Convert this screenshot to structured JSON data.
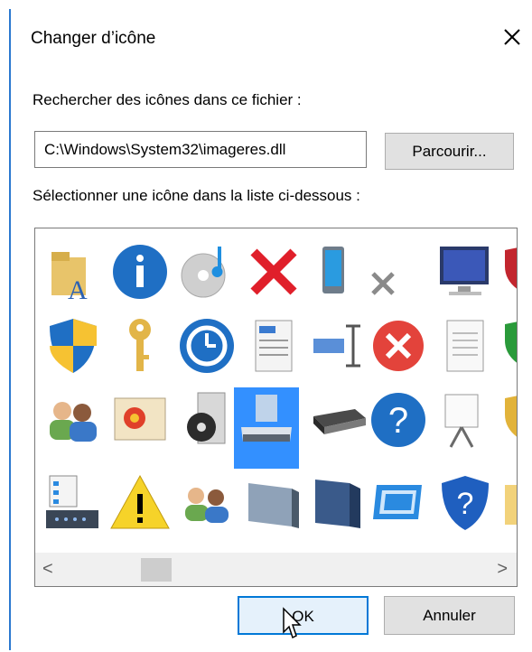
{
  "dialog": {
    "title": "Changer d’icône",
    "search_label": "Rechercher des icônes dans ce fichier :",
    "file_path": "C:\\Windows\\System32\\imageres.dll",
    "browse_label": "Parcourir...",
    "select_label": "Sélectionner une icône dans la liste ci-dessous :",
    "ok_label": "OK",
    "cancel_label": "Annuler",
    "selected_icon": "drive-icon"
  },
  "icons": [
    "folder-font-icon",
    "info-icon",
    "cd-music-icon",
    "red-x-icon",
    "device-icon",
    "small-x-icon",
    "monitor-icon",
    "shield-red-icon",
    "uac-shield-icon",
    "key-icon",
    "clock-icon",
    "text-document-icon",
    "rename-icon",
    "error-icon",
    "blank-document-icon",
    "shield-green-icon",
    "users-icon",
    "photo-icon",
    "media-icon",
    "drive-icon",
    "scanner-icon",
    "help-icon",
    "projector-icon",
    "shield-yellow-icon",
    "checklist-icon",
    "warning-icon",
    "people-icon",
    "panel-icon",
    "dark-panel-icon",
    "blue-screen-icon",
    "shield-help-icon",
    "folder-icon"
  ],
  "colors": {
    "accent": "#0078d7",
    "selection": "#3390ff"
  }
}
